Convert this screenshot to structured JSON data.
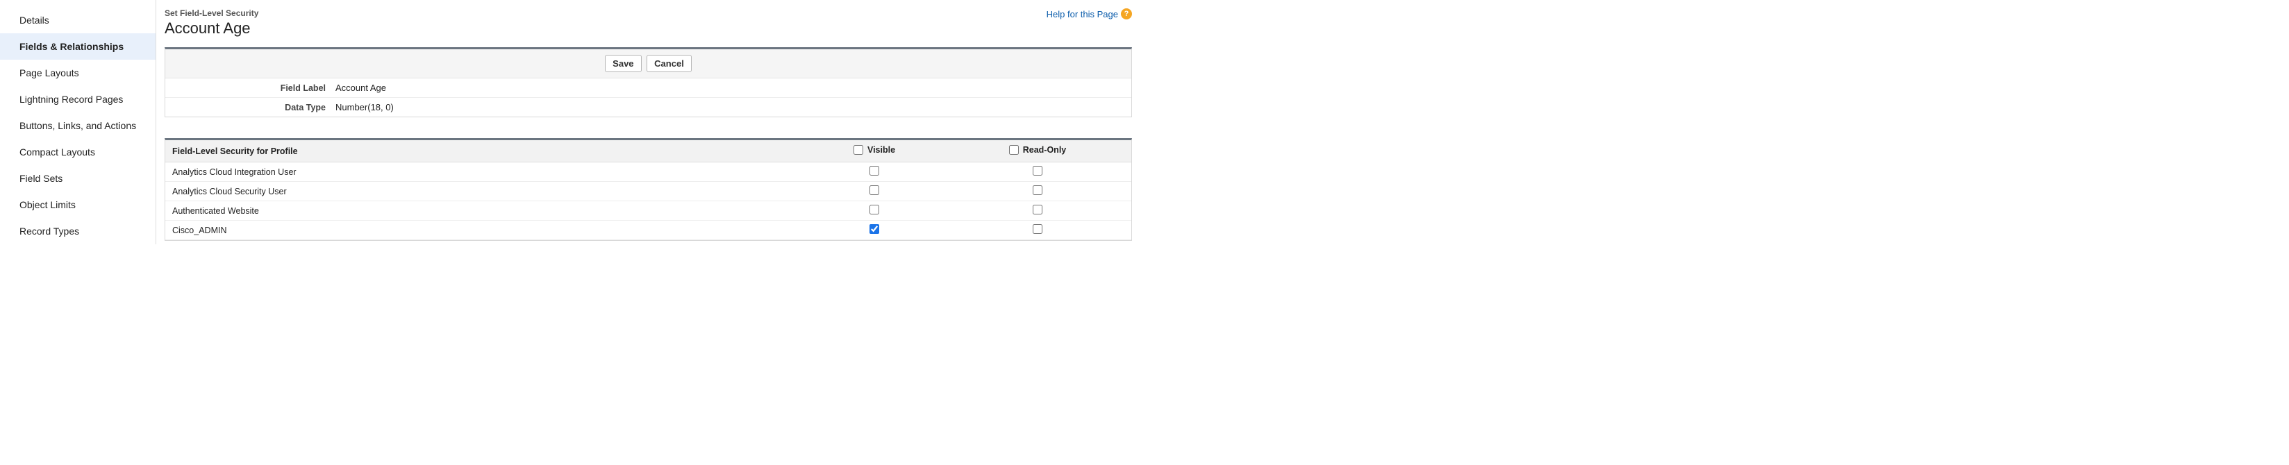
{
  "sidebar": {
    "items": [
      {
        "label": "Details",
        "active": false
      },
      {
        "label": "Fields & Relationships",
        "active": true
      },
      {
        "label": "Page Layouts",
        "active": false
      },
      {
        "label": "Lightning Record Pages",
        "active": false
      },
      {
        "label": "Buttons, Links, and Actions",
        "active": false
      },
      {
        "label": "Compact Layouts",
        "active": false
      },
      {
        "label": "Field Sets",
        "active": false
      },
      {
        "label": "Object Limits",
        "active": false
      },
      {
        "label": "Record Types",
        "active": false
      }
    ]
  },
  "header": {
    "subtitle": "Set Field-Level Security",
    "title": "Account Age",
    "help_label": "Help for this Page",
    "help_glyph": "?"
  },
  "buttons": {
    "save": "Save",
    "cancel": "Cancel"
  },
  "field_info": {
    "field_label_label": "Field Label",
    "field_label_value": "Account Age",
    "data_type_label": "Data Type",
    "data_type_value": "Number(18, 0)"
  },
  "security_table": {
    "headers": {
      "profile": "Field-Level Security for Profile",
      "visible": "Visible",
      "readonly": "Read-Only"
    },
    "header_checkboxes": {
      "visible": false,
      "readonly": false
    },
    "rows": [
      {
        "profile": "Analytics Cloud Integration User",
        "visible": false,
        "readonly": false
      },
      {
        "profile": "Analytics Cloud Security User",
        "visible": false,
        "readonly": false
      },
      {
        "profile": "Authenticated Website",
        "visible": false,
        "readonly": false
      },
      {
        "profile": "Cisco_ADMIN",
        "visible": true,
        "readonly": false
      }
    ]
  }
}
